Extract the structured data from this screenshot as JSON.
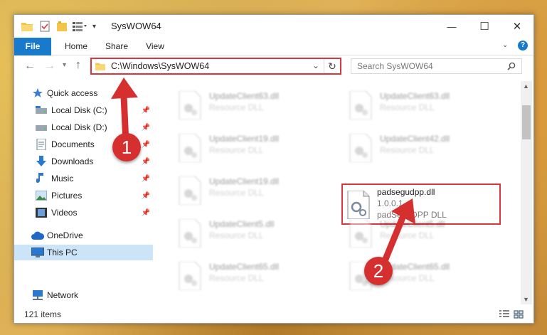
{
  "window": {
    "title": "SysWOW64",
    "controls": {
      "minimize": "—",
      "maximize": "☐",
      "close": "✕"
    }
  },
  "ribbon": {
    "tabs": [
      "File",
      "Home",
      "Share",
      "View"
    ],
    "help": "?"
  },
  "address": {
    "path": "C:\\Windows\\SysWOW64",
    "search_placeholder": "Search SysWOW64"
  },
  "sidebar": {
    "items": [
      {
        "label": "Quick access",
        "icon": "star-icon"
      },
      {
        "label": "Local Disk (C:)",
        "icon": "drive-icon"
      },
      {
        "label": "Local Disk (D:)",
        "icon": "drive-icon"
      },
      {
        "label": "Documents",
        "icon": "documents-icon"
      },
      {
        "label": "Downloads",
        "icon": "downloads-icon"
      },
      {
        "label": "Music",
        "icon": "music-icon"
      },
      {
        "label": "Pictures",
        "icon": "pictures-icon"
      },
      {
        "label": "Videos",
        "icon": "videos-icon"
      },
      {
        "label": "OneDrive",
        "icon": "cloud-icon"
      },
      {
        "label": "This PC",
        "icon": "computer-icon"
      },
      {
        "label": "Network",
        "icon": "network-icon"
      }
    ]
  },
  "files": [
    {
      "name": "UpdateClient63.dll",
      "desc": "Resource DLL"
    },
    {
      "name": "UpdateClient63.dll",
      "desc": "Resource DLL"
    },
    {
      "name": "UpdateClient19.dll",
      "desc": "Resource DLL"
    },
    {
      "name": "UpdateClient42.dll",
      "desc": "Resource DLL"
    },
    {
      "name": "UpdateClient19.dll",
      "desc": "Resource DLL"
    },
    {
      "name": "padsegudpp.dll",
      "version": "1.0.0.1",
      "desc": "padSeguDPP DLL"
    },
    {
      "name": "UpdateClient5.dll",
      "desc": "Resource DLL"
    },
    {
      "name": "UpdateClient5.dll",
      "desc": "Resource DLL"
    },
    {
      "name": "UpdateClient65.dll",
      "desc": "Resource DLL"
    },
    {
      "name": "UpdateClient65.dll",
      "desc": "Resource DLL"
    }
  ],
  "status": {
    "items": "121 items"
  },
  "annotations": {
    "step1": "1",
    "step2": "2"
  },
  "colors": {
    "accent": "#1979ca",
    "highlight": "#d9363e",
    "selection": "#cce4f7"
  }
}
